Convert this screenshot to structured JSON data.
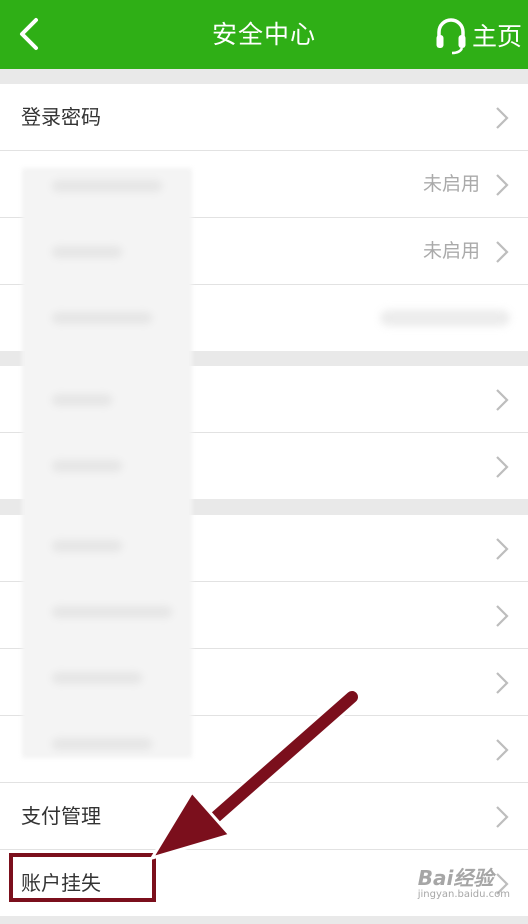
{
  "header": {
    "title": "安全中心",
    "home_label": "主页"
  },
  "rows": [
    {
      "label": "登录密码",
      "value": ""
    },
    {
      "label": "",
      "value": "未启用"
    },
    {
      "label": "",
      "value": "未启用"
    },
    {
      "label": "",
      "value": ""
    },
    {
      "label": "",
      "value": ""
    },
    {
      "label": "",
      "value": ""
    },
    {
      "label": "",
      "value": ""
    },
    {
      "label": "",
      "value": ""
    },
    {
      "label": "",
      "value": ""
    },
    {
      "label": "",
      "value": ""
    },
    {
      "label": "支付管理",
      "value": ""
    },
    {
      "label": "账户挂失",
      "value": ""
    }
  ],
  "colors": {
    "header": "#2faf16",
    "annotation": "#7b0f1c"
  },
  "watermark": {
    "brand": "Bai经验",
    "url": "jingyan.baidu.com"
  }
}
